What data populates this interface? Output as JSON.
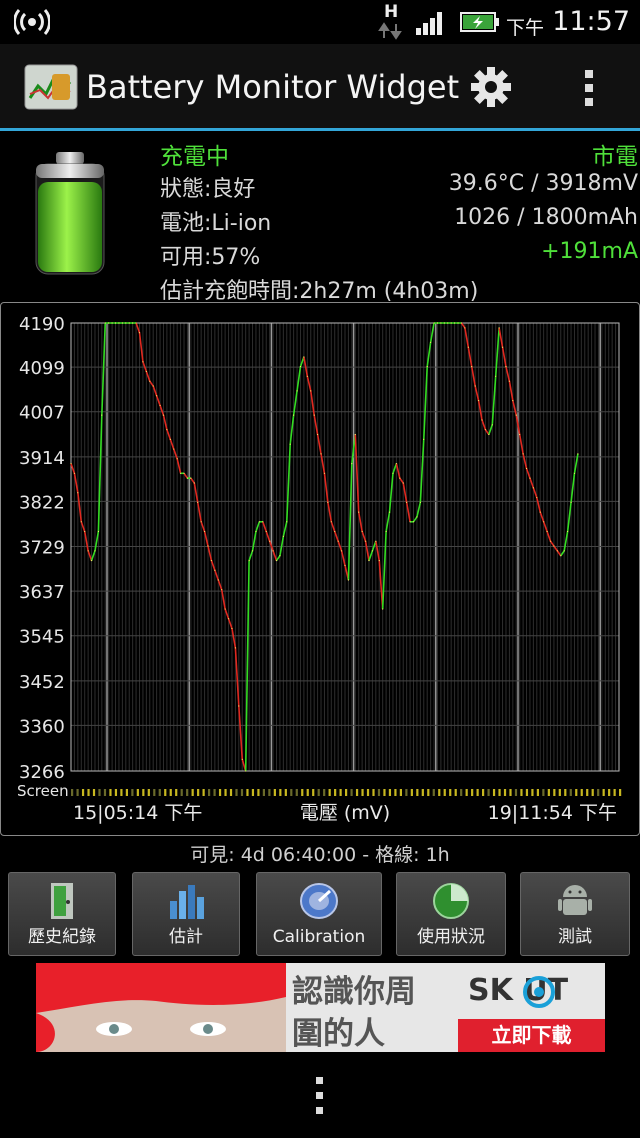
{
  "status_bar": {
    "network_type": "H",
    "ampm": "下午",
    "time": "11:57"
  },
  "app": {
    "title": "Battery Monitor Widget"
  },
  "info": {
    "charging_state": "充電中",
    "power_source": "市電",
    "health": "狀態:良好",
    "temp_voltage": "39.6°C / 3918mV",
    "battery_type": "電池:Li-ion",
    "capacity": "1026 / 1800mAh",
    "available": "可用:57%",
    "current": "+191mA",
    "estimate": "估計充飽時間:2h27m (4h03m)"
  },
  "chart_data": {
    "type": "line",
    "ylabel": "電壓 (mV)",
    "xlabel": "",
    "y_ticks": [
      4190,
      4099,
      4007,
      3914,
      3822,
      3729,
      3637,
      3545,
      3452,
      3360,
      3266
    ],
    "ylim": [
      3266,
      4190
    ],
    "x_start_label": "15|05:14 下午",
    "x_end_label": "19|11:54 下午",
    "screen_row_label": "Screen",
    "grid": true,
    "x_hours": [
      0,
      1,
      2,
      3,
      4,
      5,
      6,
      7,
      8,
      9,
      10,
      11,
      12,
      13,
      14,
      15,
      16,
      17,
      18,
      19,
      20,
      21,
      22,
      23,
      24,
      25,
      26,
      27,
      28,
      29,
      30,
      31,
      32,
      33,
      34,
      35,
      36,
      37,
      38,
      39,
      40,
      41,
      42,
      43,
      44,
      45,
      46,
      47,
      48,
      49,
      50,
      51,
      52,
      53,
      54,
      55,
      56,
      57,
      58,
      59,
      60,
      61,
      62,
      63,
      64,
      65,
      66,
      67,
      68,
      69,
      70,
      71,
      72,
      73,
      74,
      75,
      76,
      77,
      78,
      79,
      80,
      81,
      82,
      83,
      84,
      85,
      86,
      87,
      88,
      89,
      90,
      91,
      92,
      93,
      94,
      95,
      96,
      97,
      98,
      99,
      100,
      101,
      102,
      103,
      104,
      105,
      106,
      107,
      108,
      109,
      110,
      111,
      112,
      113,
      114,
      115,
      116,
      117,
      118,
      119,
      120,
      121,
      122,
      123,
      124,
      125,
      126,
      127,
      128,
      129,
      130,
      131,
      132,
      133,
      134,
      135,
      136,
      137,
      138,
      139,
      140,
      141,
      142,
      143,
      144,
      145,
      146,
      147,
      148,
      149,
      150,
      151,
      152,
      153,
      154,
      155,
      156,
      157,
      158,
      159,
      160
    ],
    "series": [
      {
        "values": [
          3900,
          3880,
          3840,
          3780,
          3760,
          3720,
          3700,
          3720,
          3760,
          4000,
          4190,
          4190,
          4190,
          4190,
          4190,
          4190,
          4190,
          4190,
          4190,
          4190,
          4170,
          4110,
          4090,
          4070,
          4060,
          4040,
          4020,
          4000,
          3970,
          3950,
          3930,
          3910,
          3880,
          3880,
          3870,
          3870,
          3860,
          3820,
          3780,
          3760,
          3730,
          3700,
          3680,
          3660,
          3640,
          3600,
          3580,
          3560,
          3520,
          3400,
          3290,
          3266,
          3700,
          3720,
          3760,
          3780,
          3780,
          3760,
          3740,
          3720,
          3700,
          3710,
          3750,
          3780,
          3940,
          4000,
          4050,
          4100,
          4120,
          4080,
          4050,
          4000,
          3960,
          3920,
          3880,
          3820,
          3780,
          3760,
          3740,
          3720,
          3690,
          3660,
          3900,
          3960,
          3800,
          3760,
          3740,
          3700,
          3720,
          3740,
          3700,
          3600,
          3760,
          3800,
          3880,
          3900,
          3870,
          3860,
          3820,
          3780,
          3780,
          3790,
          3820,
          3950,
          4100,
          4150,
          4190,
          4190,
          4190,
          4190,
          4190,
          4190,
          4190,
          4190,
          4190,
          4180,
          4140,
          4100,
          4060,
          4030,
          3990,
          3970,
          3960,
          3980,
          4080,
          4180,
          4140,
          4100,
          4070,
          4030,
          4000,
          3960,
          3920,
          3890,
          3870,
          3850,
          3830,
          3800,
          3780,
          3760,
          3740,
          3730,
          3720,
          3710,
          3720,
          3760,
          3820,
          3880,
          3920
        ]
      }
    ]
  },
  "visible_range": "可見: 4d 06:40:00 - 格線: 1h",
  "buttons": [
    "歷史紀錄",
    "估計",
    "Calibration",
    "使用狀況",
    "測試"
  ],
  "ad": {
    "line1": "認識你周",
    "line2": "圍的人",
    "brand": "SK  UT",
    "cta": "立即下載"
  }
}
